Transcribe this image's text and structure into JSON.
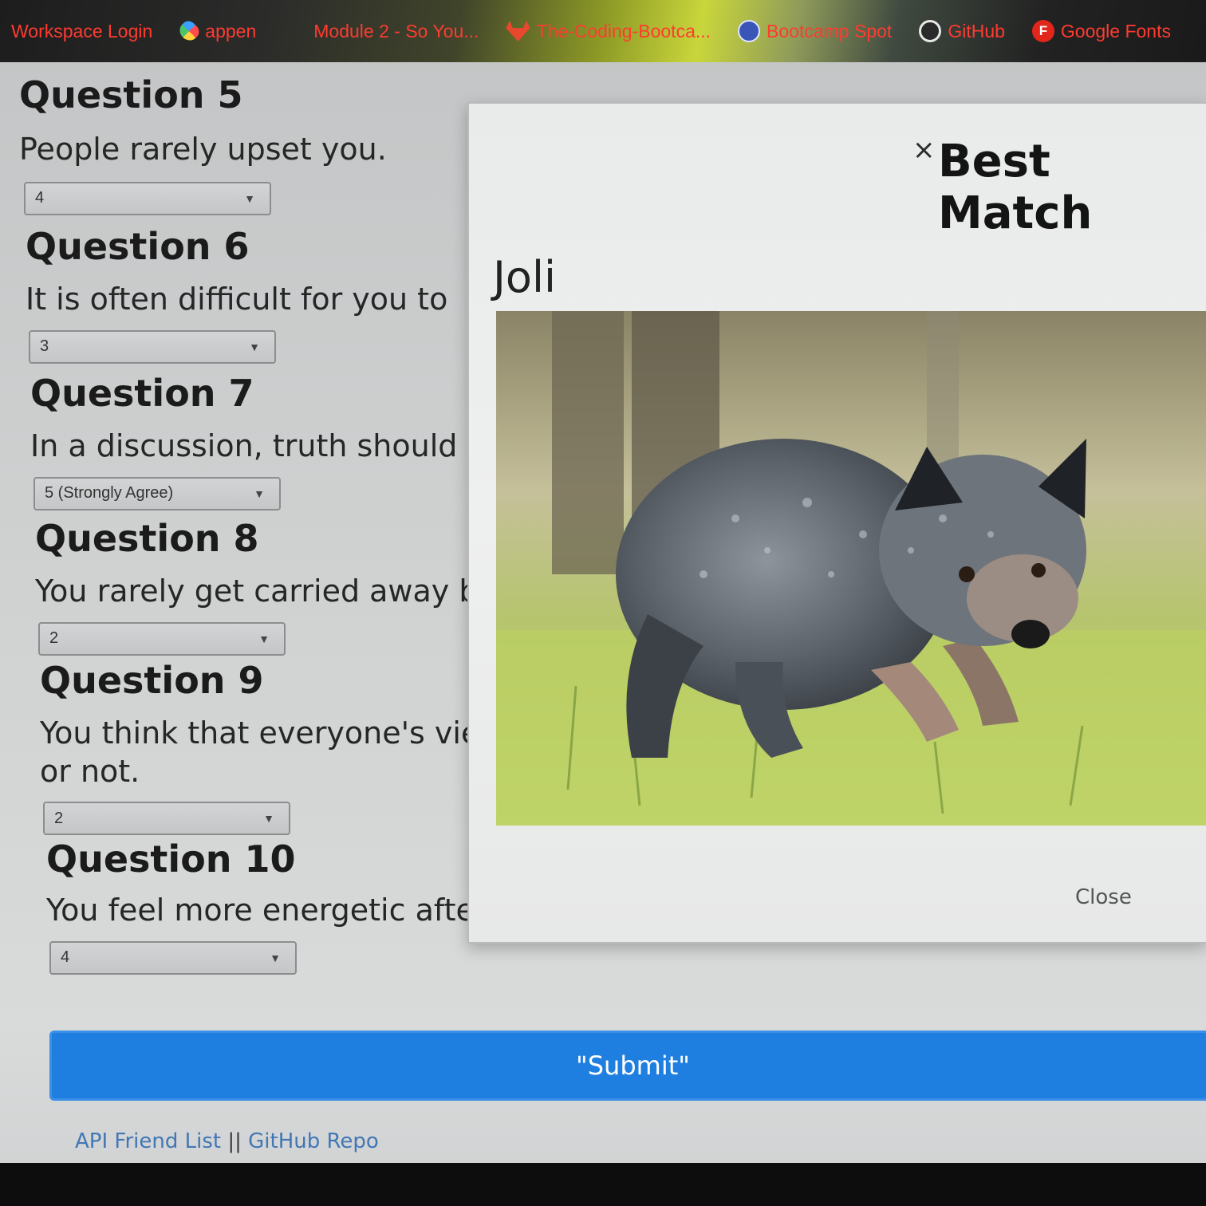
{
  "bookmarks": [
    {
      "label": "Workspace Login",
      "icon": "none"
    },
    {
      "label": "appen",
      "icon": "appen-icon"
    },
    {
      "label": "Module 2 - So You...",
      "icon": "none"
    },
    {
      "label": "The-Coding-Bootca...",
      "icon": "gitlab-icon"
    },
    {
      "label": "Bootcamp Spot",
      "icon": "bootcamp-spot-icon"
    },
    {
      "label": "GitHub",
      "icon": "github-icon"
    },
    {
      "label": "Google Fonts",
      "icon": "google-fonts-icon",
      "icon_letter": "F"
    }
  ],
  "questions": [
    {
      "title": "Question 5",
      "text": "People rarely upset you.",
      "value": "4"
    },
    {
      "title": "Question 6",
      "text": "It is often difficult for you to",
      "value": "3"
    },
    {
      "title": "Question 7",
      "text": "In a discussion, truth should",
      "value": "5 (Strongly Agree)"
    },
    {
      "title": "Question 8",
      "text": "You rarely get carried away b",
      "value": "2"
    },
    {
      "title": "Question 9",
      "text": "You think that everyone's vie",
      "text2": "or not.",
      "value": "2"
    },
    {
      "title": "Question 10",
      "text": "You feel more energetic afte",
      "value": "4"
    }
  ],
  "modal": {
    "close_x": "×",
    "title": "Best Match",
    "match_name": "Joli",
    "photo_subject": "dog-photo",
    "close_label": "Close"
  },
  "submit_label": "\"Submit\"",
  "footer": {
    "link1": "API Friend List",
    "separator": "||",
    "link2": "GitHub Repo"
  },
  "colors": {
    "bookmark_text": "#ff3b30",
    "submit_bg": "#1f7fe0",
    "link": "#4277b5"
  }
}
